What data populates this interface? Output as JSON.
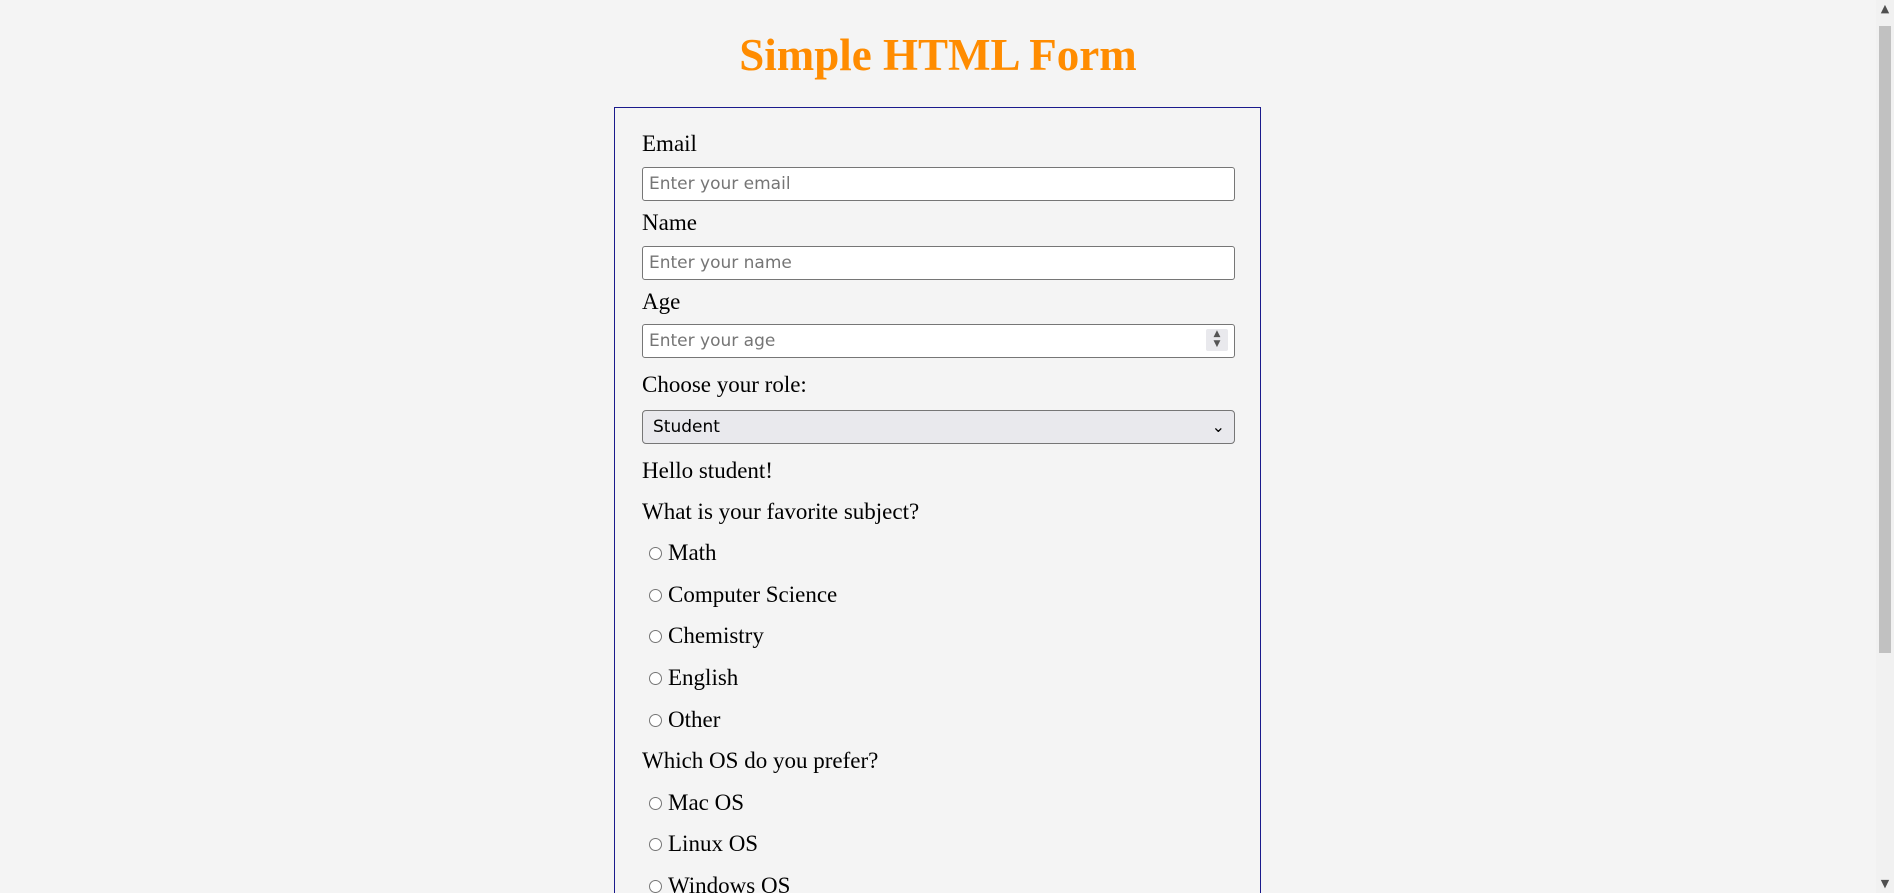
{
  "page": {
    "title": "Simple HTML Form"
  },
  "form": {
    "email": {
      "label": "Email",
      "placeholder": "Enter your email",
      "value": ""
    },
    "name": {
      "label": "Name",
      "placeholder": "Enter your name",
      "value": ""
    },
    "age": {
      "label": "Age",
      "placeholder": "Enter your age",
      "value": ""
    },
    "role": {
      "label": "Choose your role:",
      "selected": "Student"
    },
    "greeting": "Hello student!",
    "subject": {
      "question": "What is your favorite subject?",
      "options": [
        "Math",
        "Computer Science",
        "Chemistry",
        "English",
        "Other"
      ]
    },
    "os": {
      "question": "Which OS do you prefer?",
      "options": [
        "Mac OS",
        "Linux OS",
        "Windows OS"
      ]
    }
  },
  "colors": {
    "title": "#ff8c00",
    "form_border": "#1a1a8c",
    "background": "#f4f4f4"
  },
  "icons": {
    "select_arrow": "chevron-down-icon",
    "spinner": "spinner-icon",
    "scroll_up": "chevron-up-icon",
    "scroll_down": "chevron-down-icon"
  }
}
